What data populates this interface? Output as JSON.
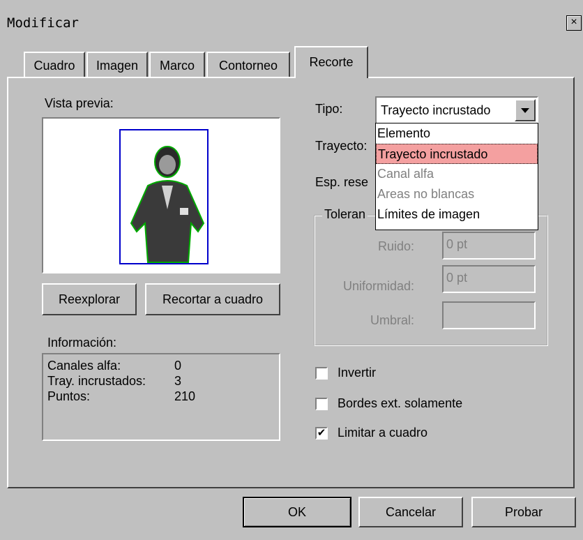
{
  "window": {
    "title": "Modificar",
    "close_label": "×"
  },
  "tabs": [
    {
      "label": "Cuadro"
    },
    {
      "label": "Imagen"
    },
    {
      "label": "Marco"
    },
    {
      "label": "Contorneo"
    },
    {
      "label": "Recorte"
    }
  ],
  "preview": {
    "label": "Vista previa:"
  },
  "buttons": {
    "reexplorar": "Reexplorar",
    "recortar": "Recortar a cuadro",
    "ok": "OK",
    "cancelar": "Cancelar",
    "probar": "Probar"
  },
  "info": {
    "label": "Información:",
    "rows": [
      {
        "name": "Canales alfa:",
        "value": "0"
      },
      {
        "name": "Tray. incrustados:",
        "value": "3"
      },
      {
        "name": "Puntos:",
        "value": "210"
      }
    ]
  },
  "tipo": {
    "label": "Tipo:",
    "selected": "Trayecto incrustado"
  },
  "trayecto": {
    "label": "Trayecto:"
  },
  "esp": {
    "label": "Esp. rese"
  },
  "tolerancia": {
    "label": "Toleran",
    "ruido": {
      "label": "Ruido:",
      "value": "0 pt"
    },
    "uniformidad": {
      "label": "Uniformidad:",
      "value": "0 pt"
    },
    "umbral": {
      "label": "Umbral:",
      "value": ""
    }
  },
  "dropdown_options": [
    {
      "label": "Elemento",
      "state": "enabled"
    },
    {
      "label": "Trayecto incrustado",
      "state": "selected"
    },
    {
      "label": "Canal alfa",
      "state": "disabled"
    },
    {
      "label": "Areas no blancas",
      "state": "disabled"
    },
    {
      "label": "Límites de imagen",
      "state": "enabled"
    }
  ],
  "checkboxes": {
    "invertir": {
      "label": "Invertir",
      "checked": false
    },
    "bordes": {
      "label": "Bordes ext. solamente",
      "checked": false
    },
    "limitar": {
      "label": "Limitar a cuadro",
      "checked": true,
      "mark": "✔"
    }
  },
  "colors": {
    "dialog_bg": "#c0c0c0",
    "selection": "#f4a0a0",
    "clip_path": "#00aa00",
    "frame": "#0000cc"
  }
}
